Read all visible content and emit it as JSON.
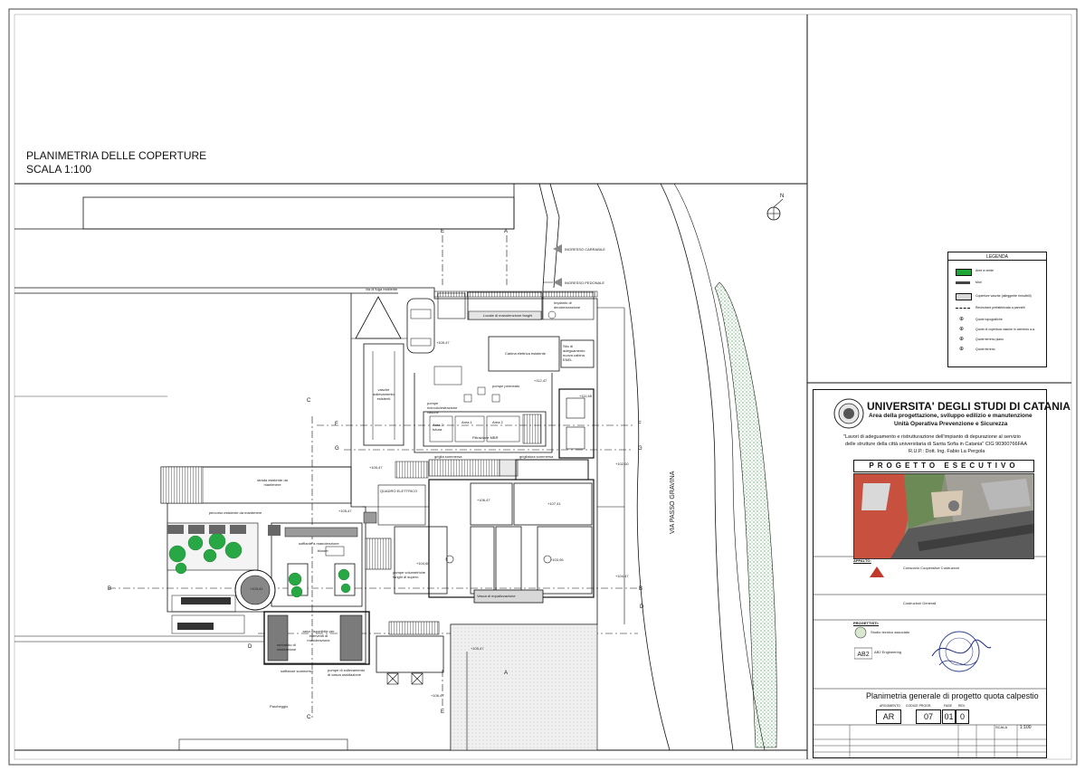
{
  "sheet": {
    "title_line1": "PLANIMETRIA DELLE COPERTURE",
    "title_line2": "SCALA 1:100",
    "north": "N"
  },
  "plan_labels": {
    "ingresso_carrabile": "INGRESSO CARRABILE",
    "ingresso_pedonale": "INGRESSO PEDONALE",
    "via_fuga": "via di fuga esistente",
    "locale_manutenzione": "Locale di manutenzione fanghi",
    "impianto_deodorizzazione": "Impianto di deodorizzazione",
    "cabina_elettrica": "Cabina elettrica esistente",
    "sito_cabina": "Sito di adeguamento nuova cabina ENEL",
    "vasche_esistenti": "vasche sollevamento esistenti",
    "pompe_permeato": "pompe permeato",
    "pompe_ricircolo": "pompe ricircolo/estrazione vasche",
    "area1": "Area 1",
    "area2": "Area 2",
    "area2_futura": "Area 2 futura",
    "filtrazione_mbr": "Filtrazione MBR",
    "vasca_equalizzazione": "Vasca di equalizzazione",
    "griglia_sommersa": "griglia sommersa",
    "grigliatura": "grigliatura sommersa",
    "area_da_mantenere": "strada esistente da mantenere",
    "percorso_esistente": "percorso esistente da mantenere",
    "soffiante": "soffiante a manutenzione",
    "blower": "blower",
    "pompe_volumetriche": "pompe volumetriche fanghi di supero",
    "carroponte": "carroponte di sollevamento",
    "gruppo_sollevamento": "gruppo di sollevamento di vasca",
    "soffiatore": "soffiatore sommerso",
    "pompe_sollevamento": "pompe di sollevamento di vasca ossidazione",
    "area_manutenzione": "area disponibile per interventi di manutenzione",
    "serbatoio_ossidazione": "serbatoio di ossidazione",
    "parcheggio": "Parcheggio",
    "via_passo_gravina": "VIA PASSO GRAVINA",
    "quadro_elettrico": "QUADRO ELETTRICO",
    "quadro_plc": "Quadro PLC"
  },
  "sections": [
    "A",
    "A",
    "B",
    "B",
    "C",
    "C",
    "D",
    "D",
    "E",
    "E",
    "F",
    "F",
    "G",
    "G"
  ],
  "elevations": [
    "+105,47",
    "+113,80",
    "+112,47",
    "+111,65",
    "+105,47",
    "+105,47",
    "+106,47",
    "+107,41",
    "+104,60",
    "+103,06",
    "+103,41",
    "+102,00",
    "+104,47",
    "+105,47",
    "+106,47"
  ],
  "legend": {
    "title": "LEGENDA",
    "items": [
      {
        "label": "Aree a verde",
        "color": "#1fa535"
      },
      {
        "label": "Muri",
        "color": "#444444"
      },
      {
        "label": "Coperture vasche (alleggerite rimovibili)",
        "color": "#d9d9d9"
      },
      {
        "label": "Recinzione prefabbricata a pannelli"
      },
      {
        "label": "Quote topografiche"
      },
      {
        "label": "Quote di copertura vasche in cemento a.a."
      },
      {
        "label": "Quote terreno piano"
      },
      {
        "label": "Quote terreno"
      }
    ]
  },
  "title_block": {
    "university": "UNIVERSITA' DEGLI STUDI DI CATANIA",
    "area": "Area della progettazione, sviluppo edilizio e manutenzione",
    "unit": "Unità Operativa Prevenzione e Sicurezza",
    "desc1": "\"Lavori di adeguamento e ristrutturazione dell'impianto di depurazione al servizio",
    "desc2": "delle strutture della città universitaria di Santa Sofia in Catania\" CIG 90300766FAA",
    "desc3": "R.U.P.: Dott. Ing. Fabio La Pergola",
    "phase": "PROGETTO ESECUTIVO",
    "appalto_label": "APPALTO:",
    "appaltatore": "Consorzio Cooperative Costruzioni",
    "company1": "Costruzioni Generali",
    "progettista_label": "PROGETTISTI:",
    "progettisti": "Studio tecnico associato",
    "ab2": "AB2 Engineering",
    "drawing_title": "Planimetria generale di progetto quota calpestio",
    "code_parts": [
      "AR",
      "07",
      "01",
      "0"
    ],
    "code_headers": [
      "ARGOMENTO",
      "CODICE PROGR.",
      "FASE",
      "REV."
    ],
    "scale_label": "SCALA",
    "scale": "1:100"
  },
  "colors": {
    "green": "#1fa535",
    "dark_wall": "#3c3c3c",
    "mid_grey": "#9a9a9a",
    "light_grey": "#cfcfcf",
    "red_logo": "#c0392b"
  }
}
